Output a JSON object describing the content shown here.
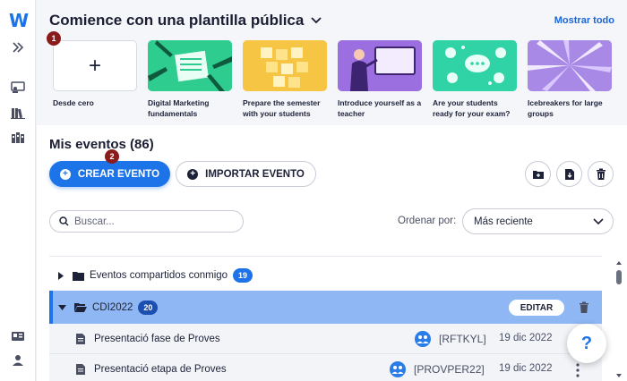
{
  "app": {
    "logo_letter": "W"
  },
  "templates": {
    "title": "Comience con una plantilla pública",
    "show_all": "Mostrar todo",
    "badge": "1",
    "cards": [
      {
        "label": "Desde cero",
        "icon": "plus-icon"
      },
      {
        "label": "Digital Marketing fundamentals",
        "color": "#2ecc8f"
      },
      {
        "label": "Prepare the semester with your students",
        "color": "#f6c544"
      },
      {
        "label": "Introduce yourself as a teacher",
        "color": "#9b6fe0"
      },
      {
        "label": "Are your students ready for your exam?",
        "color": "#2fd3a5"
      },
      {
        "label": "Icebreakers for large groups",
        "color": "#a88ae6"
      }
    ]
  },
  "events": {
    "title": "Mis eventos (86)",
    "badge": "2",
    "create_label": "CREAR EVENTO",
    "import_label": "IMPORTAR EVENTO",
    "search_placeholder": "Buscar...",
    "sort_label": "Ordenar por:",
    "sort_value": "Más reciente",
    "rows": {
      "shared": {
        "label": "Eventos compartidos conmigo",
        "count": "19"
      },
      "folder": {
        "label": "CDI2022",
        "count": "20",
        "edit_label": "EDITAR"
      },
      "items": [
        {
          "label": "Presentació fase de Proves",
          "code": "[RFTKYL]",
          "date": "19 dic 2022"
        },
        {
          "label": "Presentació etapa de Proves",
          "code": "[PROVPER22]",
          "date": "19 dic 2022"
        }
      ]
    }
  },
  "help_label": "?"
}
